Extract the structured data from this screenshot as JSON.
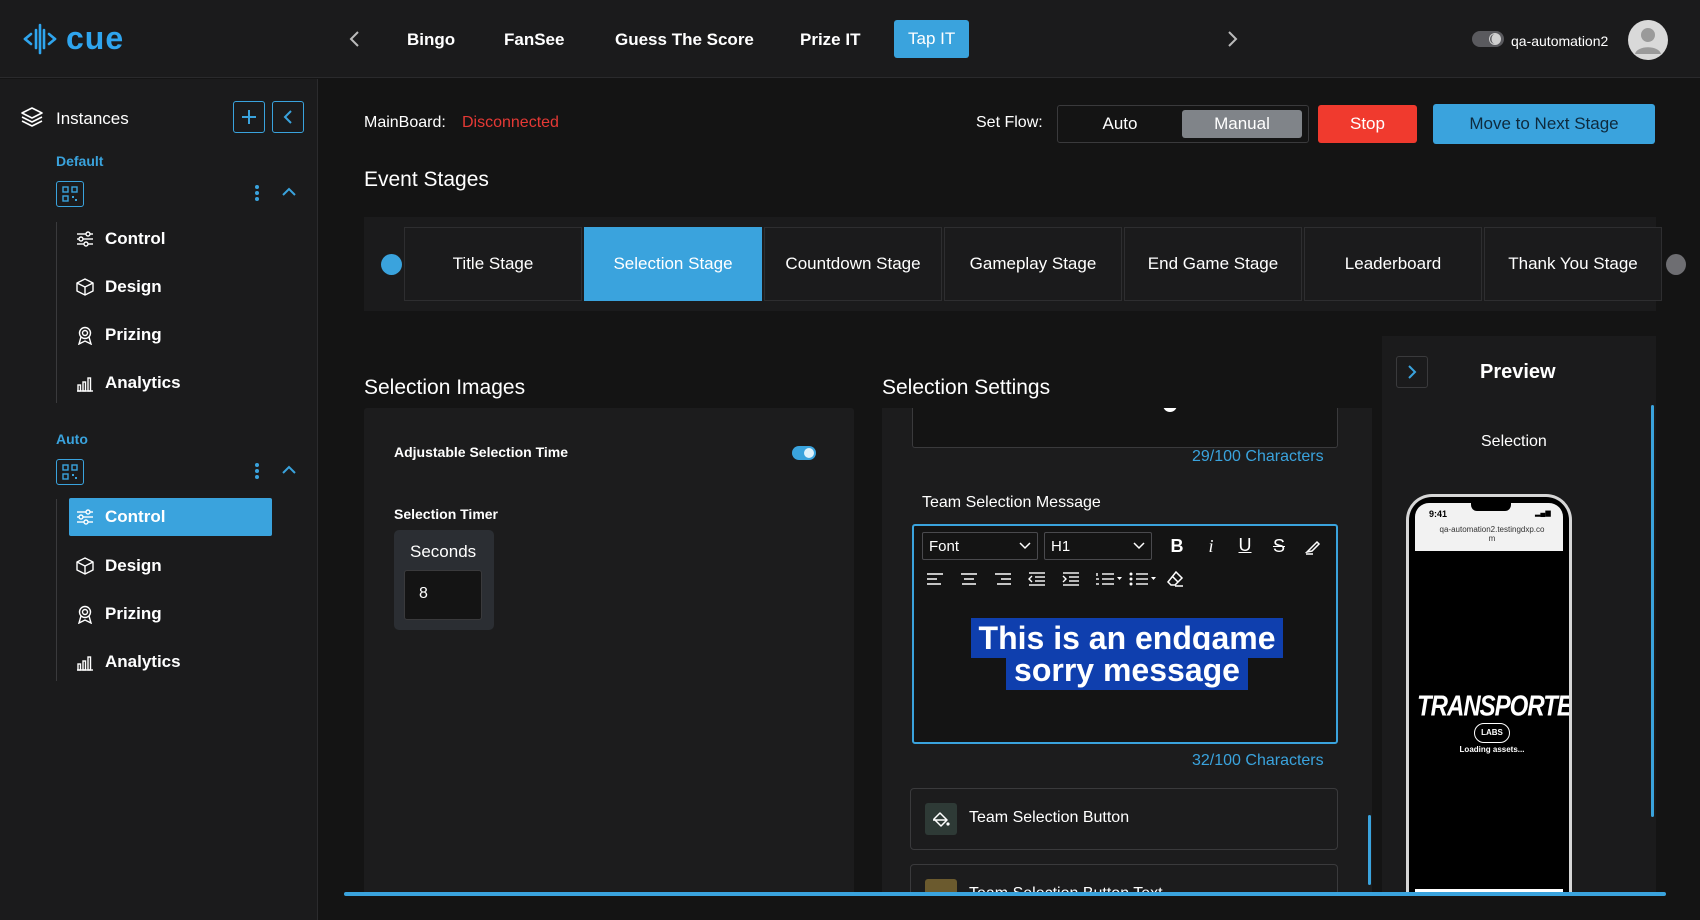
{
  "app": {
    "logo_text": "cue"
  },
  "topnav": {
    "items": [
      "Bingo",
      "FanSee",
      "Guess The Score",
      "Prize IT",
      "Tap IT"
    ],
    "active": "Tap IT",
    "username": "qa-automation2"
  },
  "sidebar": {
    "title": "Instances",
    "groups": [
      {
        "label": "Default",
        "items": [
          "Control",
          "Design",
          "Prizing",
          "Analytics"
        ]
      },
      {
        "label": "Auto",
        "items": [
          "Control",
          "Design",
          "Prizing",
          "Analytics"
        ],
        "active": "Control"
      }
    ]
  },
  "status": {
    "label": "MainBoard:",
    "value": "Disconnected",
    "value_color": "#e53935"
  },
  "flow": {
    "label": "Set Flow:",
    "options": [
      "Auto",
      "Manual"
    ],
    "selected": "Manual"
  },
  "actions": {
    "stop": "Stop",
    "next": "Move to Next Stage"
  },
  "stages": {
    "title": "Event Stages",
    "tabs": [
      "Title Stage",
      "Selection Stage",
      "Countdown Stage",
      "Gameplay Stage",
      "End Game Stage",
      "Leaderboard",
      "Thank You Stage"
    ],
    "active": "Selection Stage"
  },
  "selection_images": {
    "title": "Selection Images",
    "adjustable_label": "Adjustable Selection Time",
    "adjustable_on": true,
    "timer_label": "Selection Timer",
    "seconds_label": "Seconds",
    "seconds_value": "8"
  },
  "selection_settings": {
    "title": "Selection Settings",
    "top_char_count": "29/100 Characters",
    "message_label": "Team Selection Message",
    "font_select": "Font",
    "heading_select": "H1",
    "editor_text": "This is an endgame sorry message",
    "message_char_count": "32/100 Characters",
    "button_section": "Team Selection Button",
    "button_text_section": "Team Selection Button Text"
  },
  "preview": {
    "title": "Preview",
    "subtitle": "Selection",
    "phone_time": "9:41",
    "phone_url": "qa-automation2.testingdxp.com",
    "brand_main": "TRANSPORTED",
    "brand_sub": "LABS",
    "loading": "Loading assets..."
  },
  "colors": {
    "accent": "#3aa3dd",
    "stop": "#f03a2e",
    "danger_text": "#e53935"
  }
}
